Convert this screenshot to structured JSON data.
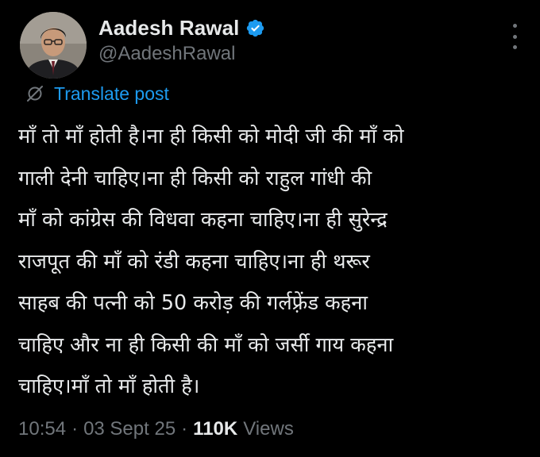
{
  "author": {
    "display_name": "Aadesh Rawal",
    "handle": "@AadeshRawal",
    "verified": true,
    "verified_color": "#1d9bf0",
    "avatar_icon": "profile-photo"
  },
  "translate": {
    "label": "Translate post",
    "icon": "globe-slash-icon"
  },
  "post": {
    "lines": [
      "माँ तो माँ होती है।ना ही किसी को मोदी जी की माँ को",
      "गाली देनी चाहिए।ना ही किसी को राहुल गांधी की",
      "माँ को कांग्रेस की विधवा कहना चाहिए।ना ही सुरेन्द्र",
      "राजपूत की माँ को रंडी कहना चाहिए।ना ही थरूर",
      "साहब की पत्नी को 50 करोड़ की गर्लफ़्रेंड कहना",
      "चाहिए और ना ही किसी की माँ को जर्सी गाय कहना",
      "चाहिए।माँ तो माँ होती है।"
    ]
  },
  "meta": {
    "time": "10:54",
    "separator": "·",
    "date": "03 Sept 25",
    "views_count": "110K",
    "views_label": "Views"
  },
  "colors": {
    "background": "#000000",
    "primary_text": "#e7e9ea",
    "secondary_text": "#71767b",
    "accent": "#1d9bf0"
  }
}
